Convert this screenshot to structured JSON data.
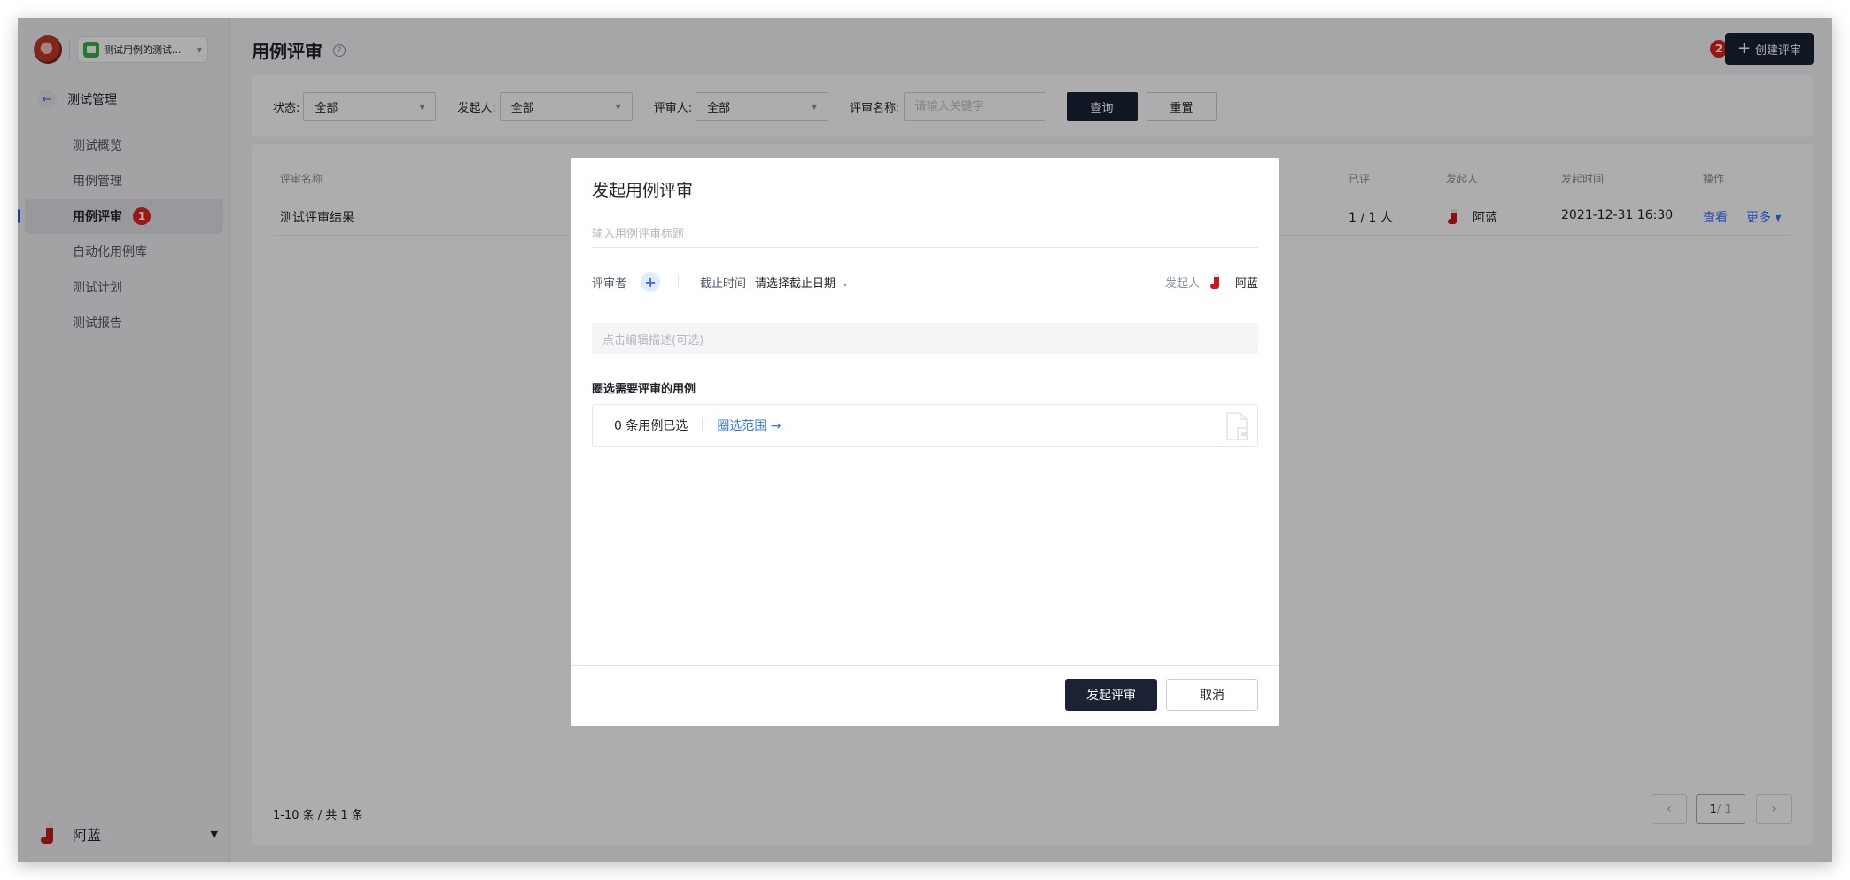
{
  "sidebar": {
    "project_name": "测试用例的测试...",
    "back_label": "测试管理",
    "items": [
      {
        "label": "测试概览"
      },
      {
        "label": "用例管理"
      },
      {
        "label": "用例评审",
        "badge": "1"
      },
      {
        "label": "自动化用例库"
      },
      {
        "label": "测试计划"
      },
      {
        "label": "测试报告"
      }
    ],
    "user_name": "阿蓝"
  },
  "header": {
    "title": "用例评审",
    "help_icon": "?",
    "create_badge": "2",
    "create_label": "创建评审",
    "create_plus": "+"
  },
  "filters": {
    "status_label": "状态:",
    "status_value": "全部",
    "initiator_label": "发起人:",
    "initiator_value": "全部",
    "reviewer_label": "评审人:",
    "reviewer_value": "全部",
    "name_label": "评审名称:",
    "name_placeholder": "请输入关键字",
    "query_label": "查询",
    "reset_label": "重置"
  },
  "table": {
    "columns": {
      "name": "评审名称",
      "reviewed": "已评",
      "initiator": "发起人",
      "time": "发起时间",
      "actions": "操作"
    },
    "rows": [
      {
        "name": "测试评审结果",
        "reviewed": "1 / 1 人",
        "initiator": "阿蓝",
        "time": "2021-12-31 16:30",
        "view": "查看",
        "more": "更多",
        "more_caret": "▾"
      }
    ],
    "pagination_info": "1-10 条 / 共 1 条",
    "page_current": "1",
    "page_total": "/ 1",
    "prev_icon": "‹",
    "next_icon": "›"
  },
  "modal": {
    "title": "发起用例评审",
    "title_placeholder": "输入用例评审标题",
    "reviewer_label": "评审者",
    "add_reviewer": "+",
    "due_label": "截止时间",
    "due_value": "请选择截止日期",
    "due_caret": "▾",
    "initiator_label": "发起人",
    "initiator_name": "阿蓝",
    "desc_placeholder": "点击编辑描述(可选)",
    "section_title": "圈选需要评审的用例",
    "cases_selected": "0 条用例已选",
    "cases_link": "圈选范围 →",
    "submit_label": "发起评审",
    "cancel_label": "取消"
  },
  "colors": {
    "primary_dark": "#1a2233",
    "link_blue": "#3370ff",
    "badge_red": "#e5201e"
  }
}
